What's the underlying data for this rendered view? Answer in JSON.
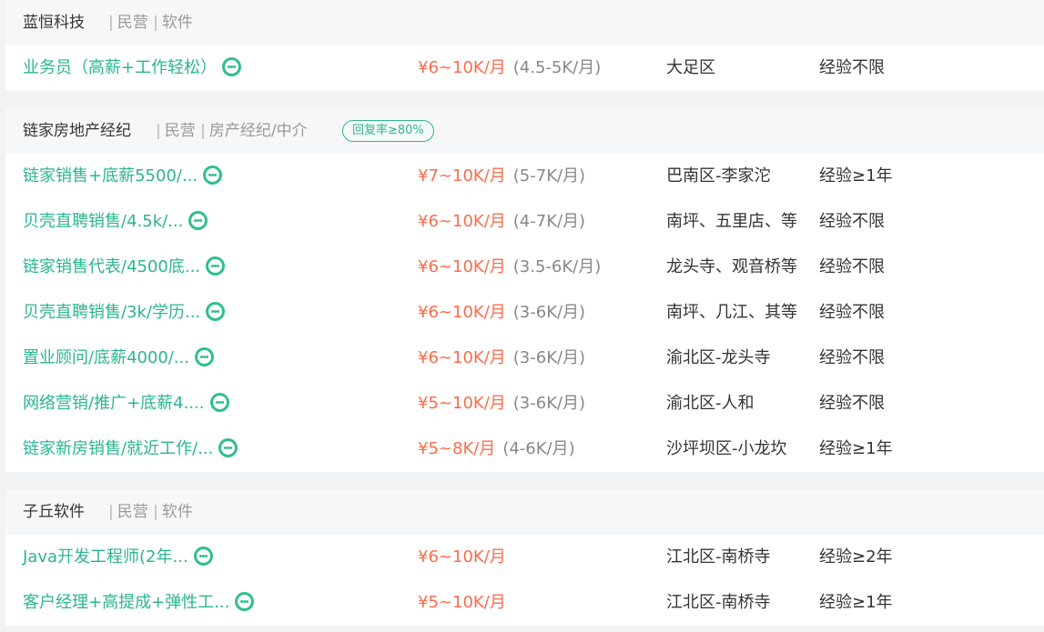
{
  "companies": [
    {
      "name": "蓝恒科技",
      "ownership": "民营",
      "industry": "软件",
      "reply_badge": "",
      "jobs": [
        {
          "title": "业务员（高薪+工作轻松）",
          "salary": "¥6~10K/月",
          "salary_range": "(4.5-5K/月)",
          "location": "大足区",
          "experience": "经验不限"
        }
      ]
    },
    {
      "name": "链家房地产经纪",
      "ownership": "民营",
      "industry": "房产经纪/中介",
      "reply_badge": "回复率≥80%",
      "jobs": [
        {
          "title": "链家销售+底薪5500/...",
          "salary": "¥7~10K/月",
          "salary_range": "(5-7K/月)",
          "location": "巴南区-李家沱",
          "experience": "经验≥1年"
        },
        {
          "title": "贝壳直聘销售/4.5k/...",
          "salary": "¥6~10K/月",
          "salary_range": "(4-7K/月)",
          "location": "南坪、五里店、等",
          "experience": "经验不限"
        },
        {
          "title": "链家销售代表/4500底...",
          "salary": "¥6~10K/月",
          "salary_range": "(3.5-6K/月)",
          "location": "龙头寺、观音桥等",
          "experience": "经验不限"
        },
        {
          "title": "贝壳直聘销售/3k/学历...",
          "salary": "¥6~10K/月",
          "salary_range": "(3-6K/月)",
          "location": "南坪、几江、其等",
          "experience": "经验不限"
        },
        {
          "title": "置业顾问/底薪4000/...",
          "salary": "¥6~10K/月",
          "salary_range": "(3-6K/月)",
          "location": "渝北区-龙头寺",
          "experience": "经验不限"
        },
        {
          "title": "网络营销/推广+底薪4....",
          "salary": "¥5~10K/月",
          "salary_range": "(3-6K/月)",
          "location": "渝北区-人和",
          "experience": "经验不限"
        },
        {
          "title": "链家新房销售/就近工作/...",
          "salary": "¥5~8K/月",
          "salary_range": "(4-6K/月)",
          "location": "沙坪坝区-小龙坎",
          "experience": "经验≥1年"
        }
      ]
    },
    {
      "name": "子丘软件",
      "ownership": "民营",
      "industry": "软件",
      "reply_badge": "",
      "jobs": [
        {
          "title": "Java开发工程师(2年...",
          "salary": "¥6~10K/月",
          "salary_range": "",
          "location": "江北区-南桥寺",
          "experience": "经验≥2年"
        },
        {
          "title": "客户经理+高提成+弹性工...",
          "salary": "¥5~10K/月",
          "salary_range": "",
          "location": "江北区-南桥寺",
          "experience": "经验≥1年"
        }
      ]
    }
  ],
  "colors": {
    "job_title": "#2bb592",
    "salary": "#fc6c4c",
    "chat_icon": "#2fbf8d",
    "badge": "#35b38d"
  },
  "icons": {
    "chat": "chat-bubble-icon"
  }
}
